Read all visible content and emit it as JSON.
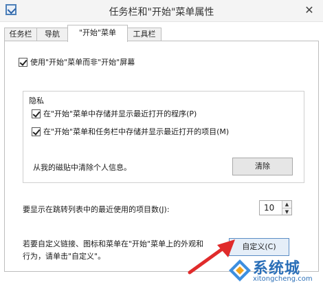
{
  "window": {
    "title": "任务栏和\"开始\"菜单属性",
    "close_glyph": "✕"
  },
  "tabs": [
    {
      "label": "任务栏"
    },
    {
      "label": "导航"
    },
    {
      "label": "\"开始\"菜单"
    },
    {
      "label": "工具栏"
    }
  ],
  "start_menu": {
    "use_start_screen_label": "使用\"开始\"菜单而非\"开始\"屏幕",
    "privacy": {
      "title": "隐私",
      "store_programs_label": "在\"开始\"菜单中存储并显示最近打开的程序(P)",
      "store_items_label": "在\"开始\"菜单和任务栏中存储并显示最近打开的项目(M)",
      "clear_text": "从我的磁贴中清除个人信息。",
      "clear_button": "清除"
    },
    "jump_list_label": "要显示在跳转列表中的最近使用的项目数(J):",
    "jump_list_value": "10",
    "customize_text_line1": "若要自定义链接、图标和菜单在\"开始\"菜单上的外观和",
    "customize_text_line2": "行为，请单击\"自定义\"。",
    "customize_button": "自定义(C)"
  },
  "watermark": {
    "brand": "系统城",
    "url": "xitongcheng.com"
  },
  "colors": {
    "accent": "#2a6fb8",
    "arrow": "#e02b2b"
  }
}
